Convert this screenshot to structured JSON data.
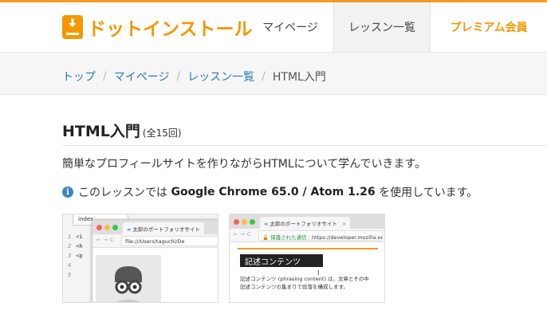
{
  "header": {
    "logo_text": "ドットインストール",
    "nav": {
      "mypage": "マイページ",
      "lessons": "レッスン一覧",
      "premium": "プレミアム会員"
    }
  },
  "breadcrumb": {
    "top": "トップ",
    "mypage": "マイページ",
    "lessons": "レッスン一覧",
    "current": "HTML入門",
    "separator": "/"
  },
  "main": {
    "title": "HTML入門",
    "count": "(全15回)",
    "description": "簡単なプロフィールサイトを作りながらHTMLについて学んでいきます。",
    "env": {
      "prefix": "このレッスンでは",
      "tools": "Google Chrome 65.0 / Atom 1.26",
      "suffix": "を使用しています。"
    }
  },
  "thumb1": {
    "editor_tab": "index",
    "line_numbers": [
      "1",
      "2",
      "3",
      "4",
      "5"
    ],
    "code_lines": [
      "<i",
      "<h",
      "<p",
      "",
      ""
    ],
    "tab_title": "太郎のポートフォリオサイト",
    "address": "file:///Users/taguchi/De"
  },
  "thumb2": {
    "tab_title": "太郎のポートフォリオサイト",
    "tab_close": "×",
    "secure_label": "保護された通信",
    "address": "https://developer.mozilla.org",
    "heading": "記述コンテンツ",
    "text_line1": "記述コンテンツ (phrasing content) は、文章とその中",
    "text_line2": "記述コンテンツの集まりで段落を構成します。"
  },
  "colors": {
    "brand_orange": "#f39800",
    "link_blue": "#2a7ab9",
    "info_blue": "#3b86c4"
  }
}
